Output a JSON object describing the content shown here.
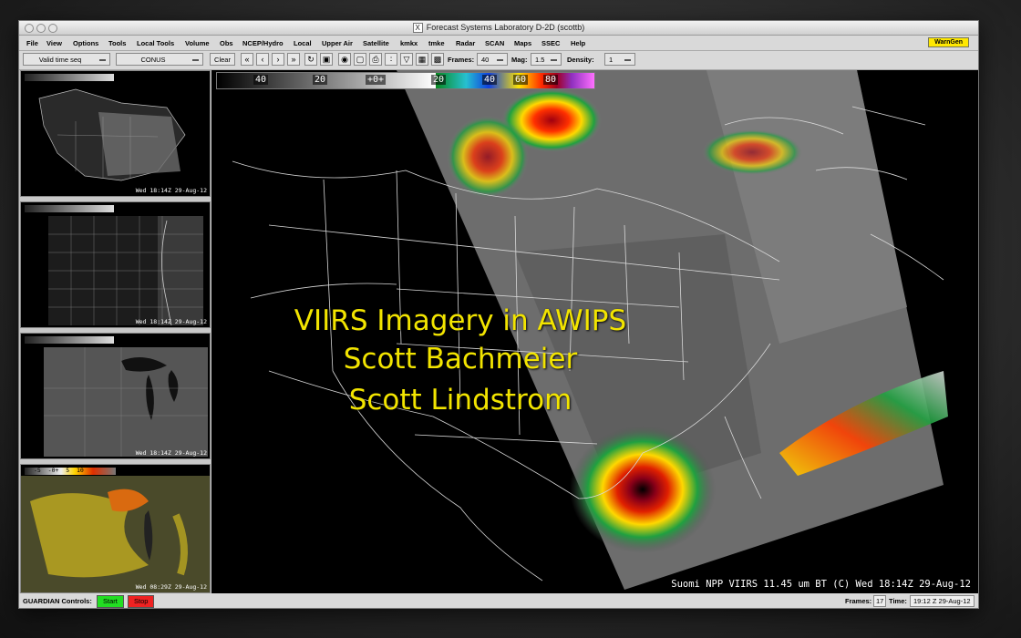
{
  "window": {
    "title": "Forecast Systems Laboratory D-2D (scottb)"
  },
  "menu": [
    "File",
    "View",
    "Options",
    "Tools",
    "Local Tools",
    "Volume",
    "Obs",
    "NCEP/Hydro",
    "Local",
    "Upper Air",
    "Satellite",
    "kmkx",
    "tmke",
    "Radar",
    "SCAN",
    "Maps",
    "SSEC",
    "Help"
  ],
  "warngen_label": "WarnGen",
  "toolbar": {
    "time_mode": "Valid time seq",
    "scale": "CONUS",
    "clear_label": "Clear",
    "frames_label": "Frames:",
    "frames_value": "40",
    "mag_label": "Mag:",
    "mag_value": "1.5",
    "density_label": "Density:",
    "density_value": "1"
  },
  "colorbar_labels": [
    "40",
    "20",
    "+0+",
    "20",
    "40",
    "60",
    "80"
  ],
  "side_panes": [
    {
      "stamp": "Wed 18:14Z 29-Aug-12"
    },
    {
      "stamp": "Wed 18:14Z 29-Aug-12"
    },
    {
      "stamp": "Wed 18:14Z 29-Aug-12"
    },
    {
      "stamp": "Wed 08:29Z 29-Aug-12",
      "scale_labels": [
        "-5",
        "-0+",
        "5",
        "10"
      ]
    }
  ],
  "overlay": {
    "line1": "VIIRS Imagery in AWIPS",
    "line2": "Scott Bachmeier",
    "line3": "Scott Lindstrom"
  },
  "main_stamp": "Suomi NPP VIIRS 11.45 um BT (C)  Wed 18:14Z 29-Aug-12",
  "status": {
    "guardian_label": "GUARDIAN Controls:",
    "start_label": "Start",
    "stop_label": "Stop",
    "frames_label": "Frames:",
    "frames_value": "17",
    "time_label": "Time:",
    "time_value": "19:12 Z 29-Aug-12"
  },
  "colors": {
    "overlay_text": "#f2e400",
    "start": "#22dd22",
    "stop": "#ee2222",
    "warngen": "#ffe800"
  }
}
